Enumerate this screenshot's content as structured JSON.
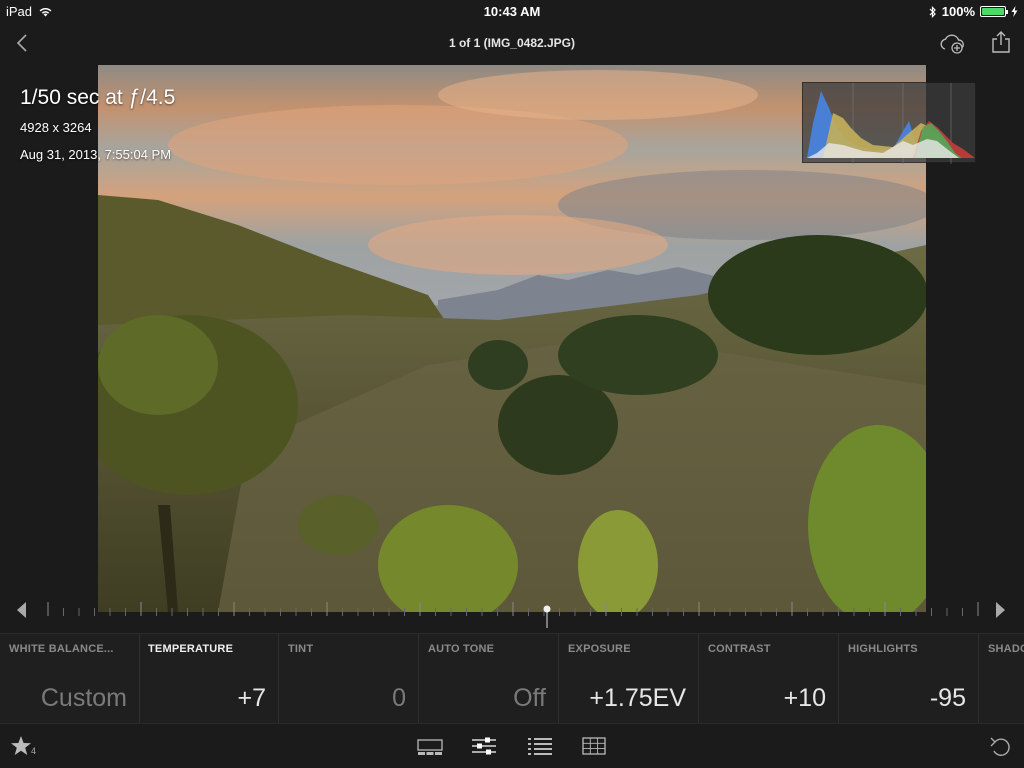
{
  "status_bar": {
    "device": "iPad",
    "time": "10:43 AM",
    "battery": "100%",
    "battery_level": 1.0
  },
  "nav": {
    "title": "1 of 1 (IMG_0482.JPG)",
    "back_icon": "chevron-left-icon",
    "cloud_icon": "cloud-add-icon",
    "share_icon": "share-icon"
  },
  "photo_info": {
    "shutter_aperture": "1/50 sec at ƒ/4.5",
    "dimensions": "4928 x 3264",
    "date": "Aug 31, 2013, 7:55:04 PM"
  },
  "adjustments": [
    {
      "label": "WHITE BALANCE...",
      "value": "Custom",
      "active": false,
      "dim": true
    },
    {
      "label": "TEMPERATURE",
      "value": "+7",
      "active": true,
      "dim": false
    },
    {
      "label": "TINT",
      "value": "0",
      "active": false,
      "dim": true
    },
    {
      "label": "AUTO TONE",
      "value": "Off",
      "active": false,
      "dim": true
    },
    {
      "label": "EXPOSURE",
      "value": "+1.75EV",
      "active": false,
      "dim": false
    },
    {
      "label": "CONTRAST",
      "value": "+10",
      "active": false,
      "dim": false
    },
    {
      "label": "HIGHLIGHTS",
      "value": "-95",
      "active": false,
      "dim": false
    },
    {
      "label": "SHADO",
      "value": "",
      "active": false,
      "dim": false
    }
  ],
  "toolbar": {
    "rating_icon": "star-icon",
    "rating_count": "4",
    "filmstrip_icon": "filmstrip-icon",
    "adjust_icon": "sliders-icon",
    "presets_icon": "list-icon",
    "crop_icon": "crop-grid-icon",
    "undo_icon": "undo-icon"
  },
  "colors": {
    "background": "#1b1b1b",
    "active_label": "#f0f0f0",
    "inactive_label": "#8a8a8a",
    "battery": "#4cd964"
  }
}
